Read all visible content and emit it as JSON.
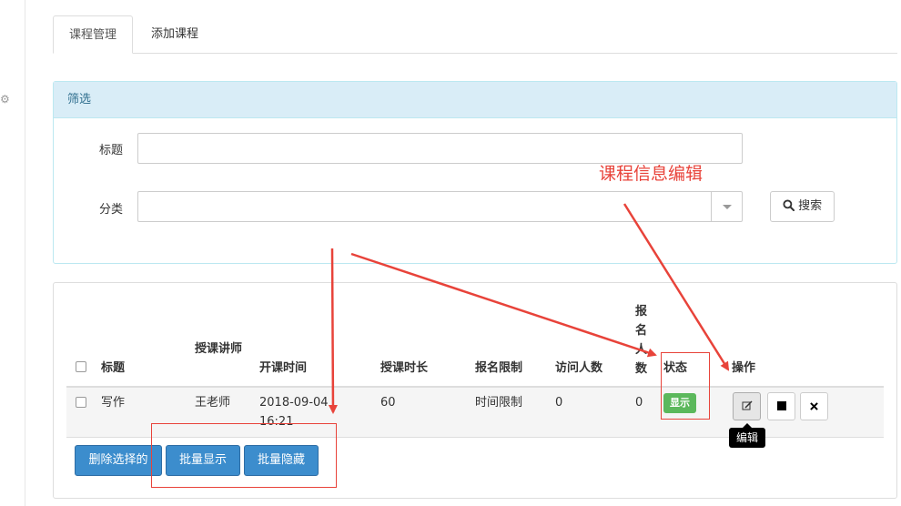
{
  "tabs": [
    {
      "label": "课程管理",
      "active": true
    },
    {
      "label": "添加课程",
      "active": false
    }
  ],
  "filter": {
    "title": "筛选",
    "fields": [
      {
        "label": "标题",
        "value": ""
      },
      {
        "label": "分类",
        "value": ""
      }
    ],
    "search_label": "搜索",
    "search_icon": "search-icon"
  },
  "table": {
    "headers": [
      "标题",
      "授课讲师",
      "开课时间",
      "授课时长",
      "报名限制",
      "访问人数",
      "报名人数",
      "状态",
      "操作"
    ],
    "rows": [
      {
        "title": "写作",
        "teacher": "王老师",
        "start": "2018-09-04 16:21",
        "duration": "60",
        "limit": "时间限制",
        "visits": "0",
        "enrolled": "0",
        "status": "显示"
      }
    ],
    "actions": [
      {
        "name": "edit",
        "icon": "edit-icon",
        "tooltip": "编辑"
      },
      {
        "name": "hide",
        "icon": "stop-icon"
      },
      {
        "name": "delete",
        "icon": "close-icon"
      }
    ],
    "bulk_buttons": [
      "删除选择的",
      "批量显示",
      "批量隐藏"
    ]
  },
  "annotation": {
    "label": "课程信息编辑",
    "color": "#e8433a"
  },
  "colors": {
    "accent": "#3c8dcd",
    "panel_head": "#d9edf7",
    "status_green": "#5cb85c"
  }
}
